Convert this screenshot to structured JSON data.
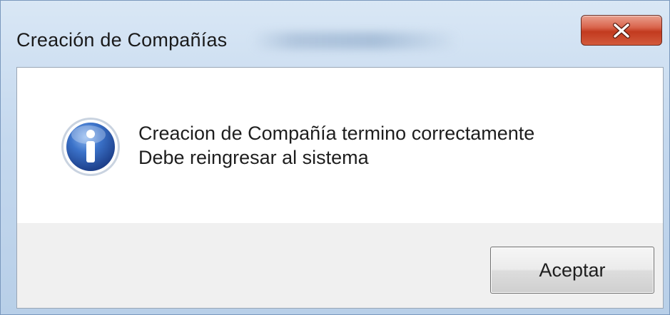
{
  "window": {
    "title": "Creación de Compañías",
    "close_icon": "close-icon"
  },
  "message": {
    "icon": "info-icon",
    "line1": "Creacion de Compañía termino correctamente",
    "line2": "Debe reingresar al sistema"
  },
  "buttons": {
    "ok_label": "Aceptar"
  },
  "colors": {
    "close_button": "#c9452b",
    "info_icon": "#2f63b8",
    "frame": "#c4d8ee"
  }
}
